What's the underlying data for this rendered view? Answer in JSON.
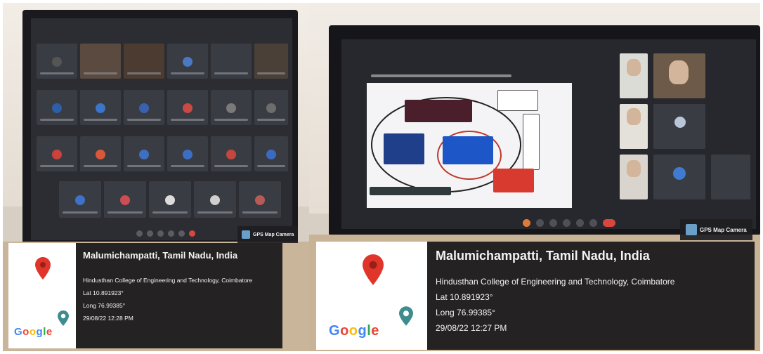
{
  "photos": [
    {
      "gps_badge": "GPS Map Camera",
      "location_title": "Malumichampatti, Tamil Nadu, India",
      "address": "Hindusthan College of Engineering and Technology, Coimbatore",
      "lat": "Lat 10.891923°",
      "long": "Long 76.99385°",
      "datetime": "29/08/22 12:28 PM",
      "logo": "Google",
      "map_pin_icon": "map-pin-icon"
    },
    {
      "gps_badge": "GPS Map Camera",
      "location_title": "Malumichampatti, Tamil Nadu, India",
      "address": "Hindusthan College of Engineering and Technology, Coimbatore",
      "lat": "Lat 10.891923°",
      "long": "Long 76.99385°",
      "datetime": "29/08/22 12:27 PM",
      "logo": "Google",
      "map_pin_icon": "map-pin-icon"
    }
  ],
  "colors": {
    "pin_red": "#e0352b",
    "google_blue": "#4285f4",
    "google_red": "#ea4335",
    "google_yellow": "#fbbc05",
    "google_green": "#34a853"
  }
}
